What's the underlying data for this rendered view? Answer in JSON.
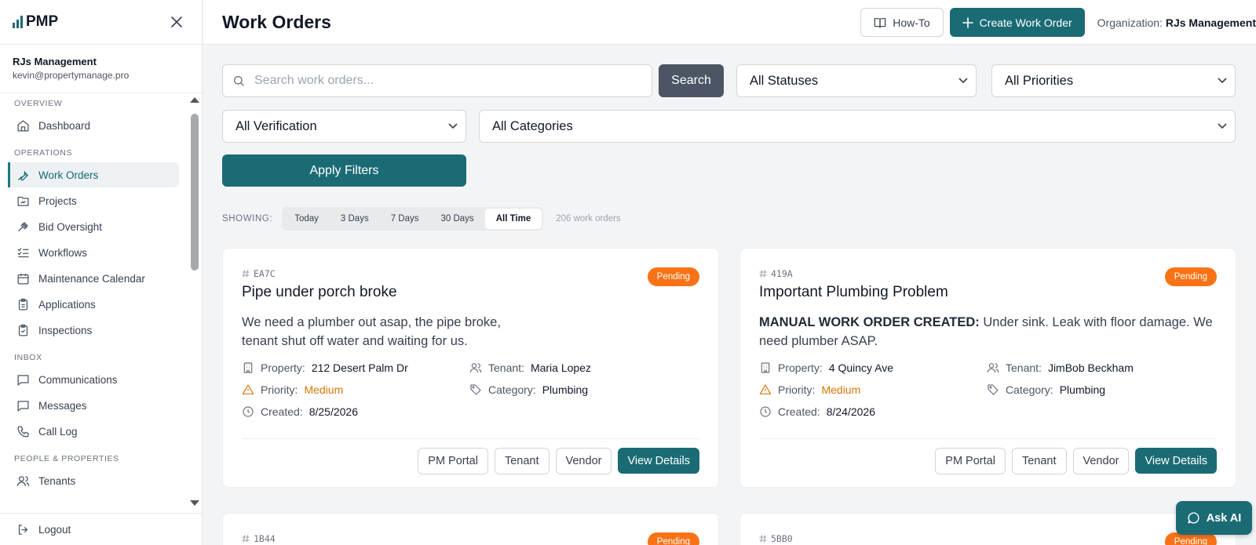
{
  "app": {
    "logo_text": "PMP"
  },
  "sidebar": {
    "org_name": "RJs Management",
    "org_email": "kevin@propertymanage.pro",
    "sections": {
      "overview": "OVERVIEW",
      "operations": "OPERATIONS",
      "inbox": "INBOX",
      "people": "PEOPLE & PROPERTIES"
    },
    "items": {
      "dashboard": "Dashboard",
      "work_orders": "Work Orders",
      "projects": "Projects",
      "bid_oversight": "Bid Oversight",
      "workflows": "Workflows",
      "maintenance_calendar": "Maintenance Calendar",
      "applications": "Applications",
      "inspections": "Inspections",
      "communications": "Communications",
      "messages": "Messages",
      "call_log": "Call Log",
      "tenants": "Tenants"
    },
    "logout": "Logout"
  },
  "header": {
    "title": "Work Orders",
    "how_to": "How-To",
    "create": "Create Work Order",
    "org_prefix": "Organization:",
    "org_name": "RJs Management"
  },
  "filters": {
    "search_placeholder": "Search work orders...",
    "search_button": "Search",
    "status": "All Statuses",
    "priority": "All Priorities",
    "verification": "All Verification",
    "category": "All Categories",
    "apply": "Apply Filters"
  },
  "range": {
    "label": "SHOWING:",
    "options": [
      "Today",
      "3 Days",
      "7 Days",
      "30 Days",
      "All Time"
    ],
    "selected": "All Time",
    "count": "206 work orders"
  },
  "labels": {
    "property": "Property:",
    "tenant": "Tenant:",
    "priority": "Priority:",
    "category": "Category:",
    "created": "Created:",
    "pm_portal": "PM Portal",
    "tenant_btn": "Tenant",
    "vendor": "Vendor",
    "view_details": "View Details"
  },
  "cards": [
    {
      "id": "EA7C",
      "status": "Pending",
      "title": "Pipe under porch broke",
      "desc_prefix": "",
      "description": "We need a plumber out asap, the pipe broke, tenant shut off water and waiting for us.",
      "property": "212 Desert Palm Dr",
      "tenant": "Maria Lopez",
      "priority": "Medium",
      "category": "Plumbing",
      "created": "8/25/2026"
    },
    {
      "id": "419A",
      "status": "Pending",
      "title": "Important Plumbing Problem",
      "desc_prefix": "MANUAL WORK ORDER CREATED:",
      "description": "Under sink. Leak with floor damage. We need plumber ASAP.",
      "property": "4 Quincy Ave",
      "tenant": "JimBob Beckham",
      "priority": "Medium",
      "category": "Plumbing",
      "created": "8/24/2026"
    },
    {
      "id": "1B44",
      "status": "Pending"
    },
    {
      "id": "5BB0",
      "status": "Pending"
    }
  ],
  "ask_ai": "Ask AI",
  "colors": {
    "accent": "#1b6b75",
    "pending": "#f97316",
    "priority_medium": "#d97706"
  }
}
